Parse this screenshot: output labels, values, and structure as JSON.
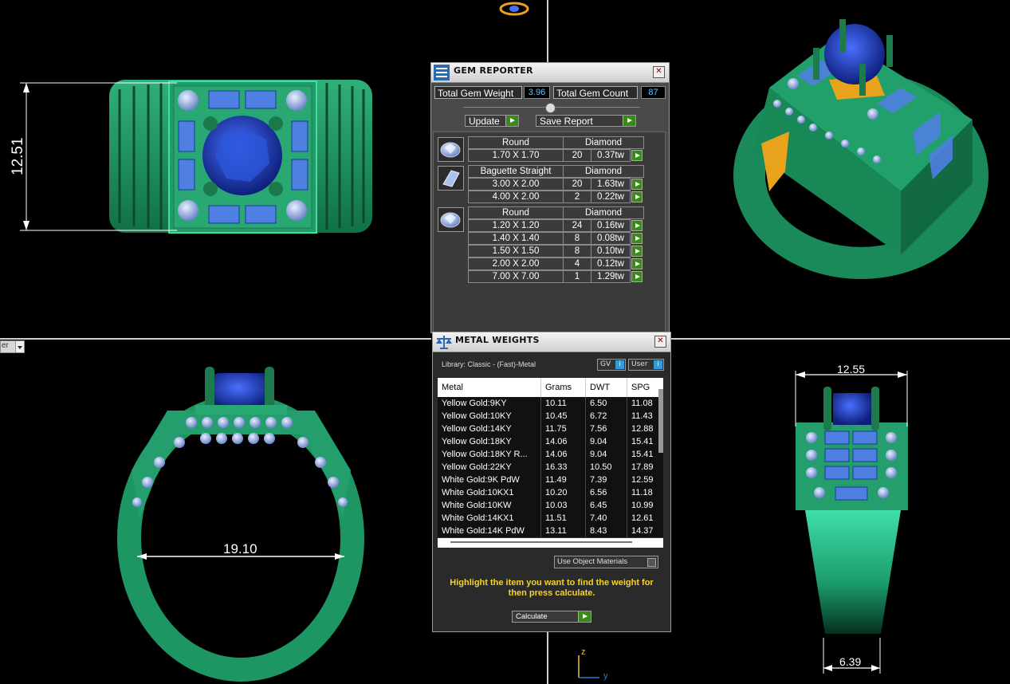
{
  "viewport": {
    "dimensions": {
      "top_left_height": "12.51",
      "front_inner_diameter": "19.10",
      "side_top_width": "12.55",
      "side_bottom_width": "6.39"
    },
    "axis": {
      "z_label": "z",
      "y_label": "y"
    },
    "left_dropdown_text": "er"
  },
  "gem_reporter": {
    "title": "GEM REPORTER",
    "total_gem_weight_label": "Total Gem Weight",
    "total_gem_weight": "3.96",
    "total_gem_count_label": "Total Gem Count",
    "total_gem_count": "87",
    "update_label": "Update",
    "save_report_label": "Save Report",
    "groups": [
      {
        "icon": "round-gem-icon",
        "shape": "Round",
        "material": "Diamond",
        "rows": [
          {
            "size": "1.70 X 1.70",
            "count": "20",
            "weight": "0.37tw"
          }
        ]
      },
      {
        "icon": "baguette-gem-icon",
        "shape": "Baguette Straight",
        "material": "Diamond",
        "rows": [
          {
            "size": "3.00 X 2.00",
            "count": "20",
            "weight": "1.63tw"
          },
          {
            "size": "4.00 X 2.00",
            "count": "2",
            "weight": "0.22tw"
          }
        ]
      },
      {
        "icon": "round-gem-icon",
        "shape": "Round",
        "material": "Diamond",
        "rows": [
          {
            "size": "1.20 X 1.20",
            "count": "24",
            "weight": "0.16tw"
          },
          {
            "size": "1.40 X 1.40",
            "count": "8",
            "weight": "0.08tw"
          },
          {
            "size": "1.50 X 1.50",
            "count": "8",
            "weight": "0.10tw"
          },
          {
            "size": "2.00 X 2.00",
            "count": "4",
            "weight": "0.12tw"
          },
          {
            "size": "7.00 X 7.00",
            "count": "1",
            "weight": "1.29tw"
          }
        ]
      }
    ]
  },
  "metal_weights": {
    "title": "METAL WEIGHTS",
    "library": "Library: Classic - (Fast)-Metal",
    "gv_label": "GV",
    "user_label": "User",
    "columns": [
      "Metal",
      "Grams",
      "DWT",
      "SPG"
    ],
    "rows": [
      [
        "Yellow Gold:9KY",
        "10.11",
        "6.50",
        "11.08"
      ],
      [
        "Yellow Gold:10KY",
        "10.45",
        "6.72",
        "11.43"
      ],
      [
        "Yellow Gold:14KY",
        "11.75",
        "7.56",
        "12.88"
      ],
      [
        "Yellow Gold:18KY",
        "14.06",
        "9.04",
        "15.41"
      ],
      [
        "Yellow Gold:18KY R...",
        "14.06",
        "9.04",
        "15.41"
      ],
      [
        "Yellow Gold:22KY",
        "16.33",
        "10.50",
        "17.89"
      ],
      [
        "White Gold:9K PdW",
        "11.49",
        "7.39",
        "12.59"
      ],
      [
        "White Gold:10KX1",
        "10.20",
        "6.56",
        "11.18"
      ],
      [
        "White Gold:10KW",
        "10.03",
        "6.45",
        "10.99"
      ],
      [
        "White Gold:14KX1",
        "11.51",
        "7.40",
        "12.61"
      ],
      [
        "White Gold:14K PdW",
        "13.11",
        "8.43",
        "14.37"
      ]
    ],
    "use_object_materials_label": "Use Object Materials",
    "hint": "Highlight the item you want to find the weight for then press calculate.",
    "calculate_label": "Calculate",
    "colors": {
      "hint": "#f5d32a",
      "play_green": "#3a8a1a",
      "value_cyan": "#5fc6ff"
    }
  },
  "colors": {
    "metal": "#1f8f60",
    "metal_light": "#3fcf96",
    "sapphire": "#1f3fb8",
    "baguette": "#4f7fe0",
    "diamond": "#b7c9ef",
    "gold_accent": "#e8a21c"
  }
}
